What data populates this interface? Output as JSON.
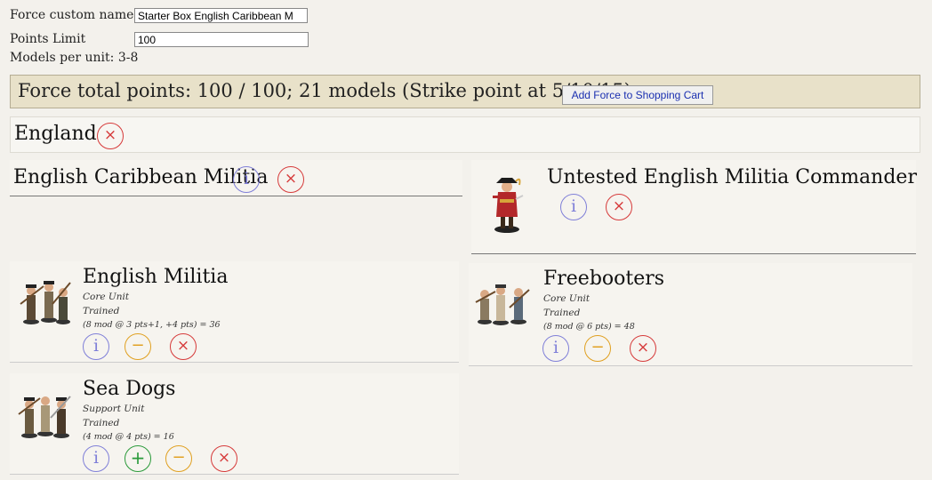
{
  "force": {
    "name_label": "Force custom name:",
    "name_value": "Starter Box English Caribbean M",
    "points_label": "Points Limit",
    "points_value": "100",
    "models_per_unit": "Models per unit: 3-8"
  },
  "totals": {
    "text": "Force total points: 100 / 100; 21 models (Strike point at 5/10/15)",
    "cart_button": "Add Force to Shopping Cart"
  },
  "nation": {
    "name": "England"
  },
  "list": {
    "name": "English Caribbean Militia"
  },
  "commander": {
    "name": "Untested English Militia Commander"
  },
  "units": [
    {
      "name": "English Militia",
      "role": "Core Unit",
      "experience": "Trained",
      "cost": "(8 mod @ 3 pts+1, +4 pts) = 36"
    },
    {
      "name": "Freebooters",
      "role": "Core Unit",
      "experience": "Trained",
      "cost": "(8 mod @ 6 pts) = 48"
    },
    {
      "name": "Sea Dogs",
      "role": "Support Unit",
      "experience": "Trained",
      "cost": "(4 mod @ 4 pts) = 16"
    }
  ],
  "icons": {
    "info": "i",
    "remove": "×",
    "decrease": "−",
    "increase": "+"
  },
  "colors": {
    "info": "#7f7fd8",
    "remove": "#d63a3a",
    "decrease": "#e0a020",
    "increase": "#2a9a3a",
    "total_bar": "#e8e1c9",
    "cart_link": "#1a2fb0"
  }
}
